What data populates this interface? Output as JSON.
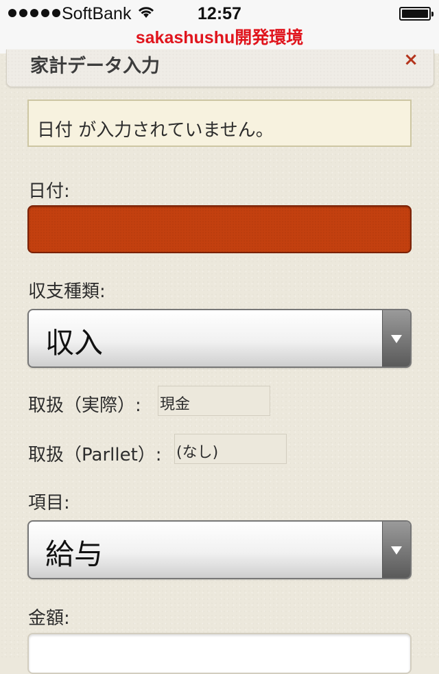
{
  "status_bar": {
    "carrier": "SoftBank",
    "time": "12:57"
  },
  "dev_banner": "sakashushu開発環境",
  "dialog": {
    "title": "家計データ入力",
    "close_label": "×"
  },
  "error_message": "日付 が入力されていません。",
  "form": {
    "date_label": "日付:",
    "date_value": "",
    "type_label": "収支種類:",
    "type_value": "収入",
    "handling_actual_label": "取扱（実際）:",
    "handling_actual_value": "現金",
    "handling_parllet_label": "取扱（Parllet）:",
    "handling_parllet_value": "(なし)",
    "item_label": "項目:",
    "item_value": "給与",
    "amount_label": "金額:",
    "amount_value": ""
  },
  "colors": {
    "error_field": "#c3400f",
    "dev_banner": "#e0151d",
    "close_icon": "#b4341c"
  }
}
